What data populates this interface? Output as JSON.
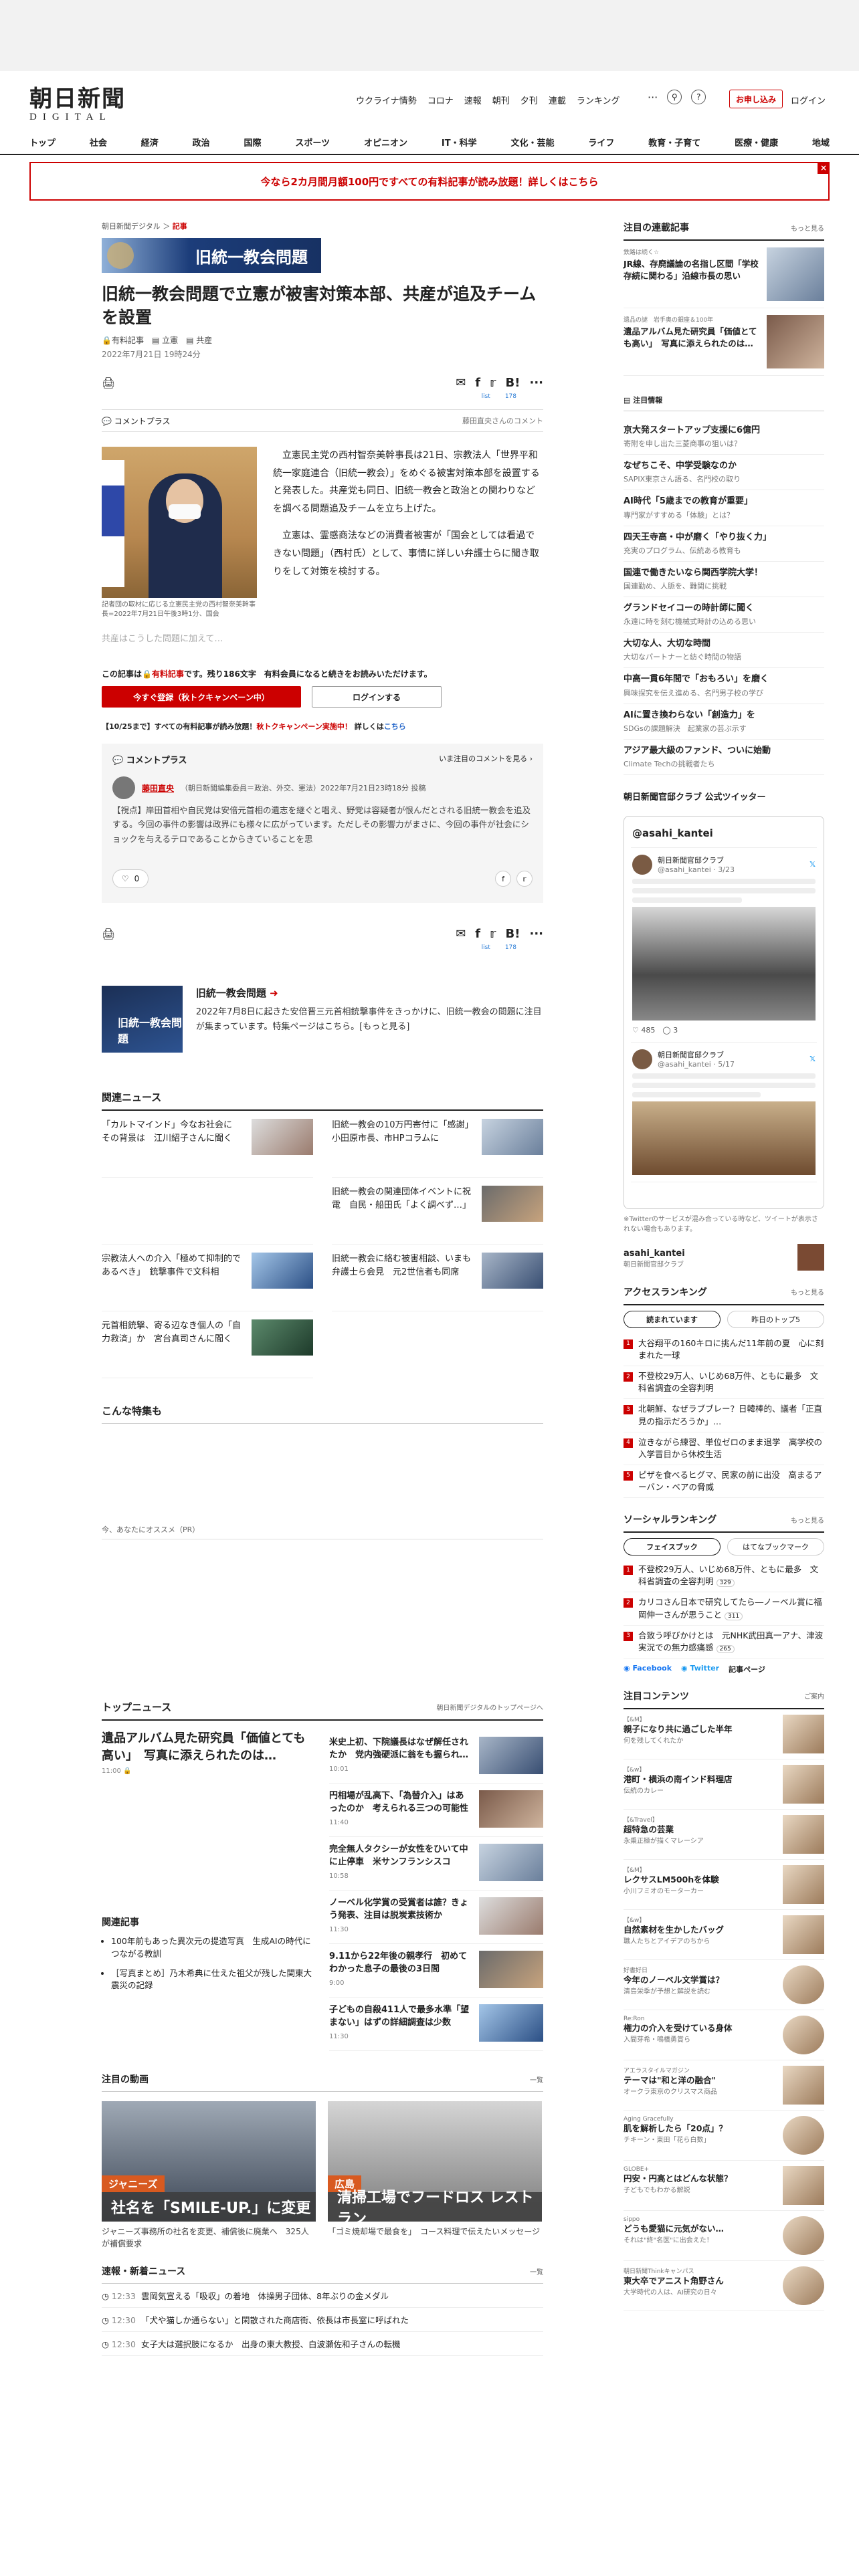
{
  "header": {
    "logo_jp": "朝日新聞",
    "logo_en": "DIGITAL",
    "nav": [
      "ウクライナ情勢",
      "コロナ",
      "速報",
      "朝刊",
      "夕刊",
      "連載",
      "ランキング"
    ],
    "more": "···",
    "subscribe": "お申し込み",
    "login": "ログイン",
    "categories": [
      "トップ",
      "社会",
      "経済",
      "政治",
      "国際",
      "スポーツ",
      "オピニオン",
      "IT・科学",
      "文化・芸能",
      "ライフ",
      "教育・子育て",
      "医療・健康",
      "地域"
    ]
  },
  "banner": {
    "text": "今なら2カ月間月額100円ですべての有料記事が読み放題！詳しくはこちら",
    "close": "×"
  },
  "article": {
    "breadcrumb_site": "朝日新聞デジタル",
    "breadcrumb_section": "記事",
    "tag_image": "旧統一教会問題",
    "title": "旧統一教会問題で立憲が被害対策本部、共産が追及チームを設置",
    "meta": [
      "有料記事",
      "立憲",
      "共産"
    ],
    "date": "2022年7月21日 19時24分",
    "share_counts": [
      "list",
      "178"
    ],
    "comment_plus": "コメントプラス",
    "comment_author_note": "藤田直央さんのコメント",
    "photo_caption": "記者団の取材に応じる立憲民主党の西村智奈美幹事長=2022年7月21日午後3時1分、国会",
    "body": [
      "立憲民主党の西村智奈美幹事長は21日、宗教法人「世界平和統一家庭連合（旧統一教会）」をめぐる被害対策本部を設置すると発表した。共産党も同日、旧統一教会と政治との関わりなどを調べる問題追及チームを立ち上げた。",
      "立憲は、霊感商法などの消費者被害が「国会としては看過できない問題」（西村氏）として、事情に詳しい弁護士らに聞き取りをして対策を検討する。"
    ],
    "fade": "共産はこうした問題に加えて…",
    "paywall_pre": "この記事は",
    "paywall_red": "有料記事",
    "paywall_post": "です。残り186文字　有料会員になると続きをお読みいただけます。",
    "register_btn": "今すぐ登録（秋トクキャンペーン中）",
    "login_btn": "ログインする",
    "campaign_pre": "【10/25まで】すべての有料記事が読み放題！",
    "campaign_red": "秋トクキャンペーン実施中！",
    "campaign_post": "詳しくは",
    "campaign_link": "こちら"
  },
  "comment": {
    "heading": "コメントプラス",
    "all": "いま注目のコメントを見る",
    "author": "藤田直央",
    "author_info": "（朝日新聞編集委員＝政治、外交、憲法）2022年7月21日23時18分 投稿",
    "text": "【視点】岸田首相や自民党は安倍元首相の遺志を継ぐと唱え、野党は容疑者が恨んだとされる旧統一教会を追及する。今回の事件の影響は政界にも様々に広がっています。ただしその影響力がまさに、今回の事件が社会にショックを与えるテロであることからきていることを思",
    "likes": "0"
  },
  "feature": {
    "image_text": "旧統一教会問題",
    "title": "旧統一教会問題",
    "desc": "2022年7月8日に起きた安倍晋三元首相銃撃事件をきっかけに、旧統一教会の問題に注目が集まっています。特集ページはこちら。",
    "more": "[もっと見る]"
  },
  "related": {
    "heading": "関連ニュース",
    "items": [
      "「カルトマインド」今なお社会に　その背景は　江川紹子さんに聞く",
      "旧統一教会の10万円寄付に「感謝」小田原市長、市HPコラムに",
      "",
      "旧統一教会の関連団体イベントに祝電　自民・船田氏「よく調べず…」",
      "宗教法人への介入「極めて抑制的であるべき」　銃撃事件で文科相",
      "旧統一教会に絡む被害相談、いまも　弁護士ら会見　元2世信者も同席",
      "元首相銃撃、寄る辺なき個人の「自力救済」か　宮台真司さんに聞く"
    ]
  },
  "specials": {
    "heading": "こんな特集も"
  },
  "recommend": {
    "label": "今、あなたにオススメ（PR）"
  },
  "top_news": {
    "heading": "トップニュース",
    "link": "朝日新聞デジタルのトップページへ",
    "lead_title": "遺品アルバム見た研究員「価値とても高い」　写真に添えられたのは…",
    "lead_time": "11:00 ",
    "items": [
      {
        "title": "米史上初、下院議長はなぜ解任されたか　党内強硬派に翁をも握られ…",
        "time": "10:01"
      },
      {
        "title": "円相場が乱高下、「為替介入」はあったのか　考えられる三つの可能性",
        "time": "11:40"
      },
      {
        "title": "完全無人タクシーが女性をひいて中に止停車　米サンフランシスコ",
        "time": "10:58"
      },
      {
        "title": "ノーベル化学賞の受賞者は誰？きょう発表、注目は脱炭素技術か",
        "time": "11:30"
      },
      {
        "title": "9.11から22年後の親孝行　初めてわかった息子の最後の3日間",
        "time": "9:00"
      },
      {
        "title": "子どもの自殺411人で最多水準「望まない」はずの詳細調査は少数",
        "time": "11:30"
      }
    ],
    "related_heading": "関連記事",
    "related": [
      "100年前もあった異次元の提造写真　生成AIの時代につながる教訓",
      "［写真まとめ］乃木希典に仕えた祖父が残した関東大震災の記録"
    ]
  },
  "videos": {
    "heading": "注目の動画",
    "more": "一覧",
    "items": [
      {
        "tag": "ジャニーズ",
        "band": "社名を「SMILE-UP.」に変更",
        "caption": "ジャニーズ事務所の社名を変更、補償後に廃業へ　325人が補償要求"
      },
      {
        "tag": "広島",
        "band": "清掃工場でフードロス レストラン",
        "caption": "「ゴミ焼却場で最食を」　コース料理で伝えたいメッセージ"
      }
    ]
  },
  "flash": {
    "heading": "速報・新着ニュース",
    "more": "一覧",
    "items": [
      {
        "time": "12:33",
        "text": "雲岡気宣える「吸収」の着地　体操男子団体、8年ぶりの金メダル"
      },
      {
        "time": "12:30",
        "text": "「犬や猫しか通らない」と閑散された商店街、依長は市長室に呼ばれた"
      },
      {
        "time": "12:30",
        "text": "女子大は選択肢になるか　出身の東大教授、白波瀬佐和子さんの転機"
      }
    ]
  },
  "sidebar": {
    "serial": {
      "heading": "注目の連載記事",
      "more": "もっと見る",
      "items": [
        {
          "series": "鉄路は続く☆",
          "title": "JR線、存廃議論の名指し区間「学校存続に関わる」沿線市長の思い"
        },
        {
          "series": "遺品の謎　岩手奥の銀座＆100年",
          "title": "遺品アルバム見た研究員「価値とても高い」　写真に添えられたのは…"
        }
      ]
    },
    "attention": {
      "heading": "注目情報",
      "items": [
        {
          "title": "京大発スタートアップ支援に6億円",
          "sub": "寄附を申し出た三菱商事の狙いは？"
        },
        {
          "title": "なぜちこそ、中学受験なのか",
          "sub": "SAPIX東京さん語る、名門校の取り"
        },
        {
          "title": "AI時代「5歳までの教育が重要」",
          "sub": "専門家がすすめる「体験」とは？"
        },
        {
          "title": "四天王寺高・中が磨く「やり抜く力」",
          "sub": "充実のプログラム、伝統ある教育も"
        },
        {
          "title": "国連で働きたいなら関西学院大学！",
          "sub": "国連勤め、人脈を、難関に挑戦"
        },
        {
          "title": "グランドセイコーの時計師に聞く",
          "sub": "永遠に時を刻む機械式時計の込める思い"
        },
        {
          "title": "大切な人、大切な時間",
          "sub": "大切なパートナーと紡ぐ時間の物語"
        },
        {
          "title": "中高一貫6年間で「おもろい」を磨く",
          "sub": "興味探究を伝え進める、名門男子校の学び"
        },
        {
          "title": "AIに置き換わらない「創造力」を",
          "sub": "SDGsの課題解決　起業家の芸ぶ示す"
        },
        {
          "title": "アジア最大級のファンド、ついに始動",
          "sub": "Climate Techの挑戦者たち"
        }
      ]
    },
    "twitter": {
      "heading": "朝日新聞官邸クラブ 公式ツイッター",
      "title": "@asahi_kantei",
      "tweets": [
        {
          "name": "朝日新聞官邸クラブ",
          "handle": "@asahi_kantei · 3/23",
          "likes": "485",
          "replies": "3"
        },
        {
          "name": "朝日新聞官邸クラブ",
          "handle": "@asahi_kantei · 5/17"
        }
      ],
      "note": "※Twitterのサービスが混み合っている時など、ツイートが表示されない場合もあります。",
      "account": "asahi_kantei",
      "account_sub": "朝日新聞官邸クラブ"
    },
    "ranking": {
      "heading": "アクセスランキング",
      "more": "もっと見る",
      "tabs": [
        "読まれています",
        "昨日のトップ5"
      ],
      "items": [
        "大谷翔平の160キロに挑んだ11年前の夏　心に刻まれた一球",
        "不登校29万人、いじめ68万件、ともに最多　文科省調査の全容判明",
        "北朝鮮、なぜラブブレー？日韓棒的、議者「正直見の指示だろうか」…",
        "泣きながら練習、単位ゼロのまま退学　高学校の入学冒目から休校生活",
        "ピザを食べるヒグマ、民家の前に出没　高まるアーバン・ベアの脅威"
      ]
    },
    "social": {
      "heading": "ソーシャルランキング",
      "more": "もっと見る",
      "tabs": [
        "フェイスブック",
        "はてなブックマーク"
      ],
      "items": [
        {
          "text": "不登校29万人、いじめ68万件、ともに最多　文科省調査の全容判明",
          "count": "329"
        },
        {
          "text": "カリコさん日本で研究してたら―ノーベル賞に福岡伸一さんが思うこと",
          "count": "311"
        },
        {
          "text": "合致う呼びかけとは　元NHK武田真一アナ、津波実況での無力感痛感",
          "count": "265"
        }
      ],
      "facebook": "Facebook",
      "twitter": "Twitter",
      "note": "記事ページ"
    },
    "noted": {
      "heading": "注目コンテンツ",
      "more": "ご案内",
      "items": [
        {
          "tag": "【&M】",
          "title": "親子になり共に過ごした半年",
          "sub": "何を残してくれたか"
        },
        {
          "tag": "【&w】",
          "title": "港町・横浜の南インド料理店",
          "sub": "伝統のカレー"
        },
        {
          "tag": "【&Travel】",
          "title": "超特急の芸業",
          "sub": "永乗正極が描くマレーシア"
        },
        {
          "tag": "【&M】",
          "title": "レクサスLM500hを体験",
          "sub": "小川フミオのモーターカー"
        },
        {
          "tag": "【&w】",
          "title": "自然素材を生かしたバッグ",
          "sub": "職人たちとアイデアのちから"
        },
        {
          "tag": "好書好日",
          "title": "今年のノーベル文学賞は？",
          "sub": "清島栄季が予想と解説を読む"
        },
        {
          "tag": "Re:Ron",
          "title": "権力の介入を受けている身体",
          "sub": "入間芽希・鳴橋勇賞ら"
        },
        {
          "tag": "アエラスタイルマガジン",
          "title": "テーマは\"和と洋の融合\"",
          "sub": "オークラ東京のクリスマス商品"
        },
        {
          "tag": "Aging Gracefully",
          "title": "肌を解析したら「20点」？",
          "sub": "チキーン・東田「花ら白数」"
        },
        {
          "tag": "GLOBE+",
          "title": "円安・円高とはどんな状態？",
          "sub": "子どもでもわかる解説"
        },
        {
          "tag": "sippo",
          "title": "どうも愛猫に元気がない…",
          "sub": "それは\"終\"名医\"に出会えた！"
        },
        {
          "tag": "朝日新聞Thinkキャンパス",
          "title": "東大卒でアニスト角野さん",
          "sub": "大学時代の人は、AI研究の日々"
        }
      ]
    }
  }
}
